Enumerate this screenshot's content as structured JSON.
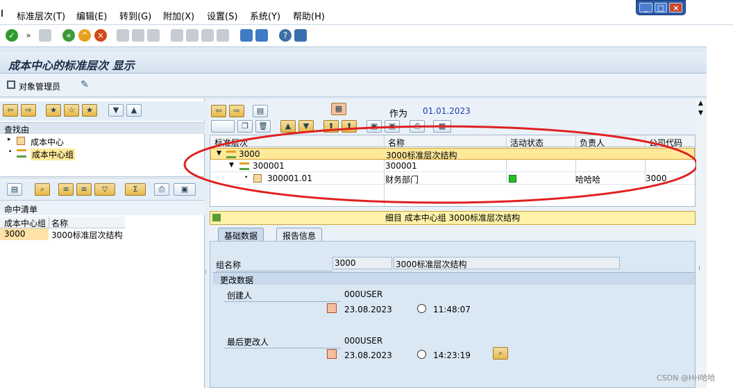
{
  "menu": [
    "标准层次(T)",
    "编辑(E)",
    "转到(G)",
    "附加(X)",
    "设置(S)",
    "系统(Y)",
    "帮助(H)"
  ],
  "title": "成本中心的标准层次 显示",
  "app_toolbar": {
    "object_manager": "对象管理员"
  },
  "left": {
    "find_by": "查找由",
    "tree": [
      "成本中心",
      "成本中心组"
    ],
    "hit_list_title": "命中清单",
    "hit_cols": [
      "成本中心组",
      "名称"
    ],
    "hit_rows": [
      [
        "3000",
        "3000标准层次结构"
      ]
    ]
  },
  "right": {
    "as_of_label": "作为",
    "as_of_date": "01.01.2023",
    "columns": [
      "标准层次",
      "名称",
      "活动状态",
      "负责人",
      "公司代码"
    ],
    "rows": [
      {
        "node": "3000",
        "name": "3000标准层次结构",
        "status": "",
        "owner": "",
        "company": ""
      },
      {
        "node": "300001",
        "name": "300001",
        "status": "",
        "owner": "",
        "company": ""
      },
      {
        "node": "300001.01",
        "name": "财务部门",
        "status": "active",
        "owner": "哈哈哈",
        "company": "3000"
      }
    ],
    "info_bar": "细目 成本中心组 3000标准层次结构",
    "tabs": [
      "基础数据",
      "报告信息"
    ],
    "group_name_label": "组名称",
    "group_name_value": "3000",
    "group_name_desc": "3000标准层次结构",
    "change_data_title": "更改数据",
    "created_by_label": "创建人",
    "created_by": "000USER",
    "created_date": "23.08.2023",
    "created_time": "11:48:07",
    "changed_by_label": "最后更改人",
    "changed_by": "000USER",
    "changed_date": "23.08.2023",
    "changed_time": "14:23:19"
  },
  "watermark": "CSDN @HH哈哈",
  "colors": {
    "highlight_row": "#ffe89a",
    "status_active": "#22c022",
    "annotation": "#e02020"
  }
}
